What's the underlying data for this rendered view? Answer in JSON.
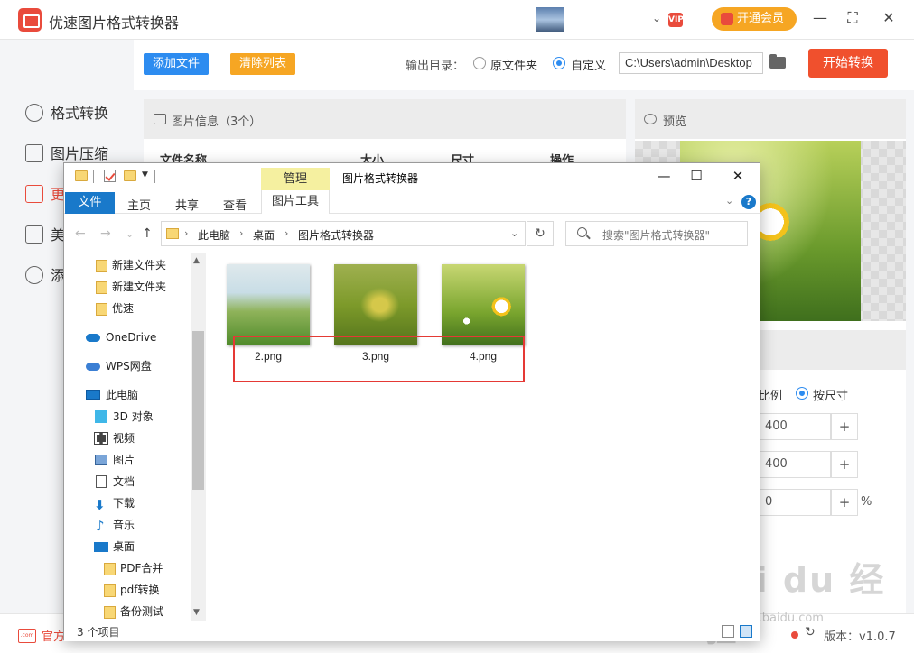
{
  "app": {
    "title": "优速图片格式转换器",
    "member_label": "开通会员",
    "vip_badge": "VIP",
    "chevron": "⌄",
    "window_controls": [
      "—",
      "⛶",
      "✕"
    ]
  },
  "sidebar": {
    "items": [
      {
        "label": "格式转换",
        "icon": "format-convert-icon"
      },
      {
        "label": "图片压缩",
        "icon": "image-compress-icon"
      },
      {
        "label": "更",
        "icon": "resize-icon",
        "active": true
      },
      {
        "label": "美",
        "icon": "beautify-icon"
      },
      {
        "label": "添",
        "icon": "watermark-icon"
      }
    ]
  },
  "toolbar": {
    "add_file": "添加文件",
    "clear_list": "清除列表",
    "output_label": "输出目录：",
    "option_original": "原文件夹",
    "option_custom": "自定义",
    "output_path": "C:\\Users\\admin\\Desktop",
    "start": "开始转换"
  },
  "info_panel": {
    "title": "图片信息（3个）",
    "columns": [
      "文件名称",
      "大小",
      "尺寸",
      "操作"
    ]
  },
  "preview_panel": {
    "title": "预览"
  },
  "settings_panel": {
    "ratio_label": "比例",
    "by_size_label": "按尺寸",
    "width": "400",
    "height": "400",
    "rotate": "0",
    "plus": "+",
    "percent": "%"
  },
  "statusbar": {
    "site": "官方",
    "site_icon": ".com",
    "refresh": "↻",
    "version": "版本：v1.0.7"
  },
  "watermark": {
    "text": "Bai du 经验",
    "sub": "jingyan.baidu.com"
  },
  "explorer": {
    "title": "图片格式转换器",
    "manage_tab": "管理",
    "ribbon": {
      "file": "文件",
      "tabs": [
        "主页",
        "共享",
        "查看"
      ],
      "tools": "图片工具",
      "help": "?"
    },
    "window_controls": [
      "—",
      "☐",
      "✕"
    ],
    "address": {
      "segments": [
        "此电脑",
        "桌面",
        "图片格式转换器"
      ],
      "separator": "›"
    },
    "search_placeholder": "搜索\"图片格式转换器\"",
    "nav_arrows": {
      "back": "←",
      "forward": "→",
      "dropdown": "⌄",
      "up": "↑"
    },
    "nav_items": [
      {
        "label": "新建文件夹",
        "icon": "folder-icon"
      },
      {
        "label": "新建文件夹",
        "icon": "folder-icon"
      },
      {
        "label": "优速",
        "icon": "folder-icon"
      },
      {
        "label": "OneDrive",
        "icon": "onedrive-icon"
      },
      {
        "label": "WPS网盘",
        "icon": "wps-cloud-icon"
      },
      {
        "label": "此电脑",
        "icon": "this-pc-icon"
      },
      {
        "label": "3D 对象",
        "icon": "3d-objects-icon"
      },
      {
        "label": "视频",
        "icon": "video-icon"
      },
      {
        "label": "图片",
        "icon": "pictures-icon"
      },
      {
        "label": "文档",
        "icon": "documents-icon"
      },
      {
        "label": "下载",
        "icon": "download-icon"
      },
      {
        "label": "音乐",
        "icon": "music-icon"
      },
      {
        "label": "桌面",
        "icon": "desktop-icon"
      },
      {
        "label": "PDF合并",
        "icon": "folder-icon"
      },
      {
        "label": "pdf转换",
        "icon": "folder-icon"
      },
      {
        "label": "备份测试",
        "icon": "folder-icon"
      }
    ],
    "files": [
      {
        "name": "2.png",
        "thumb": "golf-course"
      },
      {
        "name": "3.png",
        "thumb": "rapeseed-flowers"
      },
      {
        "name": "4.png",
        "thumb": "daisy-field"
      }
    ],
    "status_count": "3 个项目",
    "scroll_arrows": [
      "▲",
      "▼"
    ],
    "refresh": "↻",
    "expand": "⌄"
  }
}
